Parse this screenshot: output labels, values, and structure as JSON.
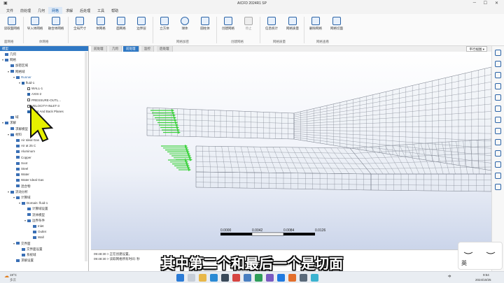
{
  "window": {
    "title": "AICFD 2024R1 SP"
  },
  "menu": [
    "文件",
    "前处理",
    "几何",
    "网格",
    "求解",
    "后处理",
    "工具",
    "帮助"
  ],
  "menu_active": "网格",
  "ribbon": {
    "buttons": [
      {
        "label": "读取面网格"
      },
      {
        "label": "导入体网格"
      },
      {
        "label": "融合体网格"
      },
      {
        "label": "全局尺寸"
      },
      {
        "label": "体网格"
      },
      {
        "label": "面网格"
      },
      {
        "label": "边界层"
      },
      {
        "label": "立方体"
      },
      {
        "label": "球体"
      },
      {
        "label": "圆柱体"
      },
      {
        "label": "创建网格"
      },
      {
        "label": "停止"
      },
      {
        "label": "信息统计"
      },
      {
        "label": "网格质量"
      },
      {
        "label": "删除网格"
      },
      {
        "label": "网格切面"
      }
    ],
    "groups": [
      "面网格",
      "体网格",
      "网格加密",
      "创建网格",
      "网格质量",
      "网格查看"
    ]
  },
  "tree": {
    "header": "模型",
    "items": [
      {
        "label": "几何",
        "level": 0
      },
      {
        "label": "网格",
        "level": 0
      },
      {
        "label": "加密区域",
        "level": 1
      },
      {
        "label": "网格域",
        "level": 1
      },
      {
        "label": "Runner",
        "level": 2
      },
      {
        "label": "fluid-1",
        "level": 3
      },
      {
        "label": "WALL-1",
        "level": 4
      },
      {
        "label": "AXIS-2",
        "level": 4
      },
      {
        "label": "PRESSURE-OUTL...",
        "level": 4
      },
      {
        "label": "VELOCITY-INLET-3",
        "level": 4
      },
      {
        "label": "Front And Back Planes",
        "level": 4
      },
      {
        "label": "域",
        "level": 1
      },
      {
        "label": "求解",
        "level": 0
      },
      {
        "label": "求解模型",
        "level": 1
      },
      {
        "label": "材料",
        "level": 1
      },
      {
        "label": "Air Ideal Gas",
        "level": 2
      },
      {
        "label": "Air at 25 C",
        "level": 2
      },
      {
        "label": "Aluminum",
        "level": 2
      },
      {
        "label": "Copper",
        "level": 2
      },
      {
        "label": "Soot",
        "level": 2
      },
      {
        "label": "Steel",
        "level": 2
      },
      {
        "label": "Water",
        "level": 2
      },
      {
        "label": "Water Ideal Gas",
        "level": 2
      },
      {
        "label": "混合物",
        "level": 2
      },
      {
        "label": "流动分析",
        "level": 1
      },
      {
        "label": "计算域",
        "level": 2
      },
      {
        "label": "Domain: fluid-1",
        "level": 3
      },
      {
        "label": "计算域设置",
        "level": 4
      },
      {
        "label": "流体模型",
        "level": 4
      },
      {
        "label": "边界条件",
        "level": 4
      },
      {
        "label": "Inlet",
        "level": 5
      },
      {
        "label": "Outlet",
        "level": 5
      },
      {
        "label": "Wall",
        "level": 5
      },
      {
        "label": "交界面",
        "level": 2
      },
      {
        "label": "交界面设置",
        "level": 3
      },
      {
        "label": "系统域",
        "level": 3
      },
      {
        "label": "求解设置",
        "level": 2
      }
    ]
  },
  "tabs": [
    {
      "label": "前处理",
      "active": false
    },
    {
      "label": "几何",
      "active": false
    },
    {
      "label": "前处理",
      "active": true
    },
    {
      "label": "监控",
      "active": false
    },
    {
      "label": "后处理",
      "active": false
    }
  ],
  "view_select": "平行视图",
  "scale_bar": [
    "0.0000",
    "0.0042",
    "0.0084",
    "0.0126"
  ],
  "console": [
    "09:48:30 > 正在创建设置。",
    "09:48:30 > 读取网格所有时间: 秒"
  ],
  "subtitle": "其中第二个和最后一个是切面",
  "ime": {
    "label": "英"
  },
  "taskbar": {
    "weather_temp": "19°C",
    "weather_text": "多云",
    "time": "9:54",
    "date": "2024/10/25",
    "ime_indicator": "中"
  },
  "colors": {
    "accent": "#2f78c4",
    "mesh_line": "#7a7f8c",
    "arrow": "#3bd23b",
    "cursor": "#e6f000"
  }
}
